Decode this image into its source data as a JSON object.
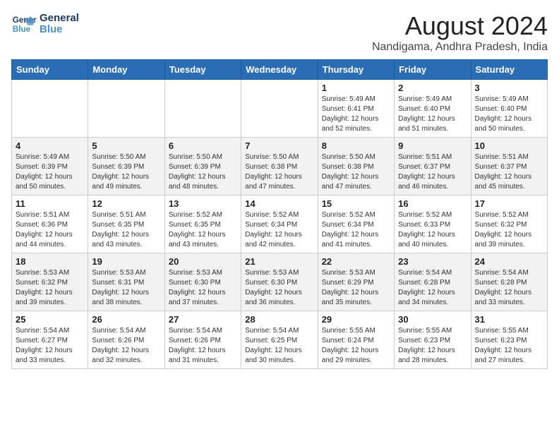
{
  "header": {
    "logo_line1": "General",
    "logo_line2": "Blue",
    "title": "August 2024",
    "subtitle": "Nandigama, Andhra Pradesh, India"
  },
  "weekdays": [
    "Sunday",
    "Monday",
    "Tuesday",
    "Wednesday",
    "Thursday",
    "Friday",
    "Saturday"
  ],
  "weeks": [
    [
      {
        "day": "",
        "info": ""
      },
      {
        "day": "",
        "info": ""
      },
      {
        "day": "",
        "info": ""
      },
      {
        "day": "",
        "info": ""
      },
      {
        "day": "1",
        "info": "Sunrise: 5:49 AM\nSunset: 6:41 PM\nDaylight: 12 hours\nand 52 minutes."
      },
      {
        "day": "2",
        "info": "Sunrise: 5:49 AM\nSunset: 6:40 PM\nDaylight: 12 hours\nand 51 minutes."
      },
      {
        "day": "3",
        "info": "Sunrise: 5:49 AM\nSunset: 6:40 PM\nDaylight: 12 hours\nand 50 minutes."
      }
    ],
    [
      {
        "day": "4",
        "info": "Sunrise: 5:49 AM\nSunset: 6:39 PM\nDaylight: 12 hours\nand 50 minutes."
      },
      {
        "day": "5",
        "info": "Sunrise: 5:50 AM\nSunset: 6:39 PM\nDaylight: 12 hours\nand 49 minutes."
      },
      {
        "day": "6",
        "info": "Sunrise: 5:50 AM\nSunset: 6:39 PM\nDaylight: 12 hours\nand 48 minutes."
      },
      {
        "day": "7",
        "info": "Sunrise: 5:50 AM\nSunset: 6:38 PM\nDaylight: 12 hours\nand 47 minutes."
      },
      {
        "day": "8",
        "info": "Sunrise: 5:50 AM\nSunset: 6:38 PM\nDaylight: 12 hours\nand 47 minutes."
      },
      {
        "day": "9",
        "info": "Sunrise: 5:51 AM\nSunset: 6:37 PM\nDaylight: 12 hours\nand 46 minutes."
      },
      {
        "day": "10",
        "info": "Sunrise: 5:51 AM\nSunset: 6:37 PM\nDaylight: 12 hours\nand 45 minutes."
      }
    ],
    [
      {
        "day": "11",
        "info": "Sunrise: 5:51 AM\nSunset: 6:36 PM\nDaylight: 12 hours\nand 44 minutes."
      },
      {
        "day": "12",
        "info": "Sunrise: 5:51 AM\nSunset: 6:35 PM\nDaylight: 12 hours\nand 43 minutes."
      },
      {
        "day": "13",
        "info": "Sunrise: 5:52 AM\nSunset: 6:35 PM\nDaylight: 12 hours\nand 43 minutes."
      },
      {
        "day": "14",
        "info": "Sunrise: 5:52 AM\nSunset: 6:34 PM\nDaylight: 12 hours\nand 42 minutes."
      },
      {
        "day": "15",
        "info": "Sunrise: 5:52 AM\nSunset: 6:34 PM\nDaylight: 12 hours\nand 41 minutes."
      },
      {
        "day": "16",
        "info": "Sunrise: 5:52 AM\nSunset: 6:33 PM\nDaylight: 12 hours\nand 40 minutes."
      },
      {
        "day": "17",
        "info": "Sunrise: 5:52 AM\nSunset: 6:32 PM\nDaylight: 12 hours\nand 39 minutes."
      }
    ],
    [
      {
        "day": "18",
        "info": "Sunrise: 5:53 AM\nSunset: 6:32 PM\nDaylight: 12 hours\nand 39 minutes."
      },
      {
        "day": "19",
        "info": "Sunrise: 5:53 AM\nSunset: 6:31 PM\nDaylight: 12 hours\nand 38 minutes."
      },
      {
        "day": "20",
        "info": "Sunrise: 5:53 AM\nSunset: 6:30 PM\nDaylight: 12 hours\nand 37 minutes."
      },
      {
        "day": "21",
        "info": "Sunrise: 5:53 AM\nSunset: 6:30 PM\nDaylight: 12 hours\nand 36 minutes."
      },
      {
        "day": "22",
        "info": "Sunrise: 5:53 AM\nSunset: 6:29 PM\nDaylight: 12 hours\nand 35 minutes."
      },
      {
        "day": "23",
        "info": "Sunrise: 5:54 AM\nSunset: 6:28 PM\nDaylight: 12 hours\nand 34 minutes."
      },
      {
        "day": "24",
        "info": "Sunrise: 5:54 AM\nSunset: 6:28 PM\nDaylight: 12 hours\nand 33 minutes."
      }
    ],
    [
      {
        "day": "25",
        "info": "Sunrise: 5:54 AM\nSunset: 6:27 PM\nDaylight: 12 hours\nand 33 minutes."
      },
      {
        "day": "26",
        "info": "Sunrise: 5:54 AM\nSunset: 6:26 PM\nDaylight: 12 hours\nand 32 minutes."
      },
      {
        "day": "27",
        "info": "Sunrise: 5:54 AM\nSunset: 6:26 PM\nDaylight: 12 hours\nand 31 minutes."
      },
      {
        "day": "28",
        "info": "Sunrise: 5:54 AM\nSunset: 6:25 PM\nDaylight: 12 hours\nand 30 minutes."
      },
      {
        "day": "29",
        "info": "Sunrise: 5:55 AM\nSunset: 6:24 PM\nDaylight: 12 hours\nand 29 minutes."
      },
      {
        "day": "30",
        "info": "Sunrise: 5:55 AM\nSunset: 6:23 PM\nDaylight: 12 hours\nand 28 minutes."
      },
      {
        "day": "31",
        "info": "Sunrise: 5:55 AM\nSunset: 6:23 PM\nDaylight: 12 hours\nand 27 minutes."
      }
    ]
  ]
}
